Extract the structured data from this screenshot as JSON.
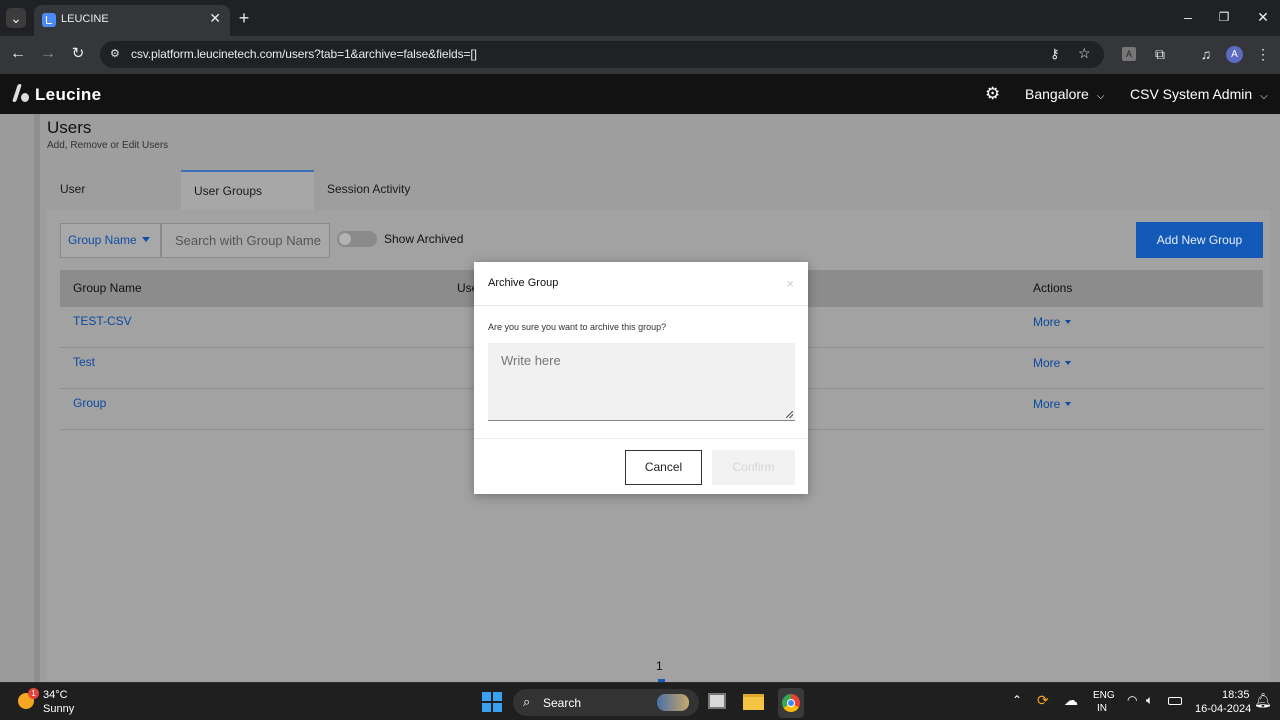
{
  "browser": {
    "tab_title": "LEUCINE",
    "url": "csv.platform.leucinetech.com/users?tab=1&archive=false&fields=[]",
    "profile_initial": "A"
  },
  "header": {
    "logo": "Leucine",
    "location": "Bangalore",
    "user": "CSV System Admin"
  },
  "page": {
    "title": "Users",
    "subtitle": "Add, Remove or Edit Users",
    "tabs": [
      {
        "label": "User"
      },
      {
        "label": "User Groups"
      },
      {
        "label": "Session Activity"
      }
    ]
  },
  "filters": {
    "field_select": "Group Name",
    "search_placeholder": "Search with Group Name",
    "show_archived_label": "Show Archived",
    "show_archived": false,
    "add_button": "Add New Group"
  },
  "table": {
    "columns": [
      "Group Name",
      "Use",
      "Actions"
    ],
    "rows": [
      {
        "name": "TEST-CSV",
        "action": "More"
      },
      {
        "name": "Test",
        "action": "More"
      },
      {
        "name": "Group",
        "action": "More"
      }
    ]
  },
  "pagination": {
    "current_page": "1"
  },
  "modal": {
    "title": "Archive Group",
    "close": "×",
    "question": "Are you sure you want to archive this group?",
    "textarea_placeholder": "Write here",
    "cancel_label": "Cancel",
    "confirm_label": "Confirm"
  },
  "taskbar": {
    "weather_temp": "34°C",
    "weather_desc": "Sunny",
    "weather_badge": "1",
    "search_label": "Search",
    "lang_line1": "ENG",
    "lang_line2": "IN",
    "time": "18:35",
    "date": "16-04-2024"
  },
  "colors": {
    "primary": "#1259b8",
    "link": "#0b4aa0",
    "header_bg": "#121212",
    "overlay_bg": "#9e9e9e"
  }
}
